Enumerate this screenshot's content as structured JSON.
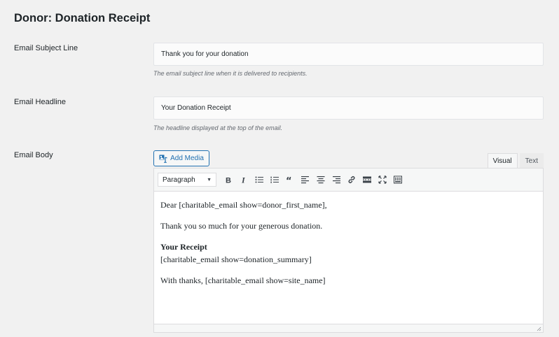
{
  "page": {
    "title": "Donor: Donation Receipt"
  },
  "subject": {
    "label": "Email Subject Line",
    "value": "Thank you for your donation",
    "help": "The email subject line when it is delivered to recipients."
  },
  "headline": {
    "label": "Email Headline",
    "value": "Your Donation Receipt",
    "help": "The headline displayed at the top of the email."
  },
  "body": {
    "label": "Email Body",
    "add_media": "Add Media",
    "tabs": {
      "visual": "Visual",
      "text": "Text"
    },
    "format_select": "Paragraph",
    "toolbar_icons": [
      "bold-icon",
      "italic-icon",
      "bullet-list-icon",
      "numbered-list-icon",
      "blockquote-icon",
      "align-left-icon",
      "align-center-icon",
      "align-right-icon",
      "link-icon",
      "read-more-icon",
      "fullscreen-icon",
      "kitchen-sink-icon"
    ],
    "content": {
      "line1": "Dear [charitable_email show=donor_first_name],",
      "line2": "Thank you so much for your generous donation.",
      "line3": "Your Receipt",
      "line4": "[charitable_email show=donation_summary]",
      "line5": "With thanks, [charitable_email show=site_name]"
    }
  },
  "colors": {
    "accent": "#2271b1",
    "background": "#f1f1f1"
  }
}
